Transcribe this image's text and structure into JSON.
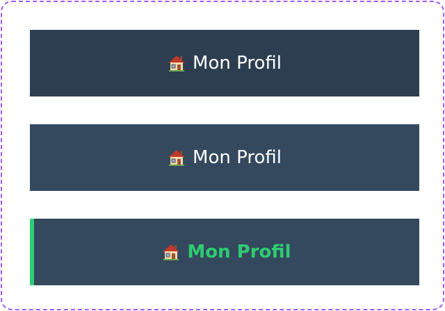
{
  "menu": {
    "items": [
      {
        "icon": "house-icon",
        "label": "Mon Profil",
        "state": "default"
      },
      {
        "icon": "house-icon",
        "label": "Mon Profil",
        "state": "hover"
      },
      {
        "icon": "house-icon",
        "label": "Mon Profil",
        "state": "active"
      }
    ]
  },
  "colors": {
    "default_bg": "#2d3e50",
    "hover_bg": "#34495e",
    "active_bg": "#34495e",
    "active_accent": "#2ecc71",
    "text": "#ffffff",
    "frame_border": "#a259f7"
  }
}
